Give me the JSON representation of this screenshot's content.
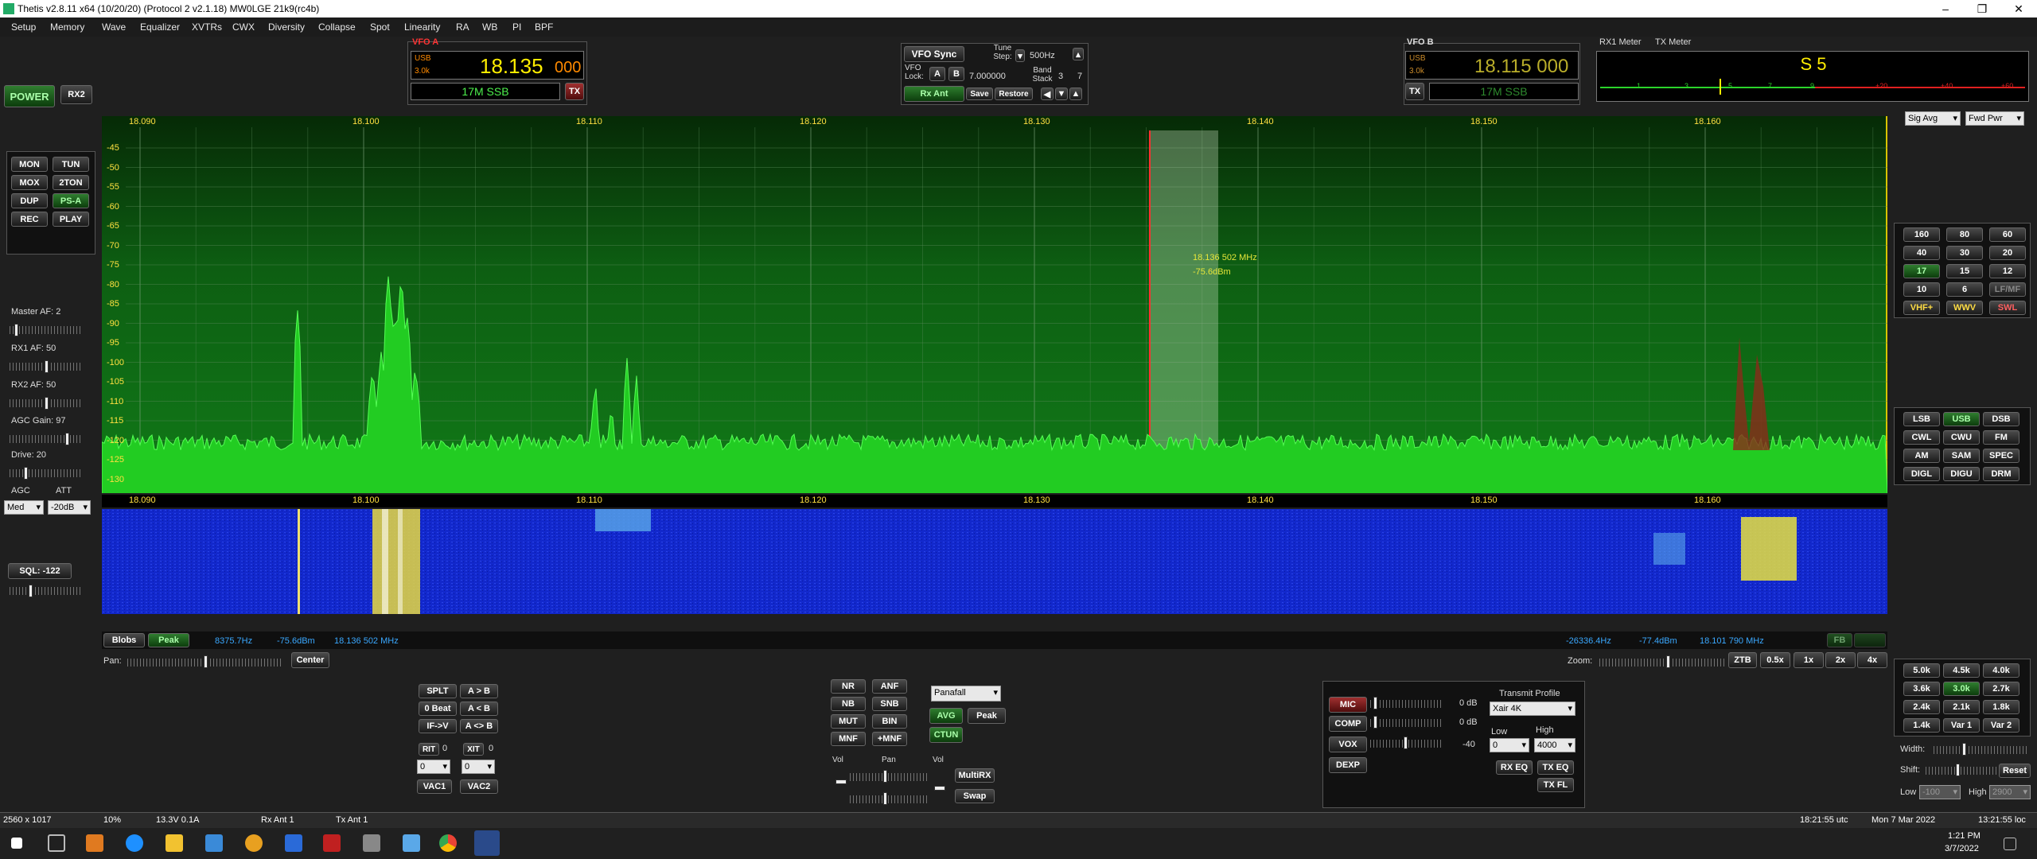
{
  "window": {
    "title": "Thetis v2.8.11 x64 (10/20/20) (Protocol 2 v2.1.18) MW0LGE 21k9(rc4b)"
  },
  "menu": [
    "Setup",
    "Memory",
    "Wave",
    "Equalizer",
    "XVTRs",
    "CWX",
    "Diversity",
    "Collapse",
    "Spot",
    "Linearity",
    "RA",
    "WB",
    "PI",
    "BPF"
  ],
  "left": {
    "power": "POWER",
    "rx2": "RX2",
    "buttons": [
      "MON",
      "TUN",
      "MOX",
      "2TON",
      "DUP",
      "PS-A",
      "REC",
      "PLAY"
    ],
    "master_af": "Master AF:  2",
    "rx1_af": "RX1 AF:  50",
    "rx2_af": "RX2 AF:  50",
    "agc_gain": "AGC Gain:  97",
    "drive": "Drive:  20",
    "agc": "AGC",
    "att": "ATT",
    "agc_val": "Med",
    "att_val": "-20dB",
    "sql": "SQL: -122"
  },
  "vfoa": {
    "label": "VFO A",
    "mode": "USB",
    "bw": "3.0k",
    "freq_main": "18.135",
    "freq_sub": "000",
    "band": "17M SSB",
    "tx": "TX"
  },
  "vfocenter": {
    "sync": "VFO Sync",
    "tune_step": "Tune Step:",
    "step": "500Hz",
    "vfo_lock": "VFO Lock:",
    "a": "A",
    "b": "B",
    "lock_freq": "7.000000",
    "band_stack": "Band Stack",
    "stack_a": "3",
    "stack_b": "7",
    "rx_ant": "Rx Ant",
    "save": "Save",
    "restore": "Restore"
  },
  "vfob": {
    "label": "VFO B",
    "mode": "USB",
    "bw": "3.0k",
    "freq": "18.115 000",
    "tx": "TX",
    "band": "17M SSB"
  },
  "meter": {
    "rx1": "RX1 Meter",
    "tx": "TX Meter",
    "reading": "S 5",
    "scale": [
      "1",
      "3",
      "5",
      "7",
      "9",
      "+20",
      "+40",
      "+60"
    ],
    "rx_mode": "Sig Avg",
    "tx_mode": "Fwd Pwr"
  },
  "display": {
    "freq_ticks": [
      "18.090",
      "18.100",
      "18.110",
      "18.120",
      "18.130",
      "18.140",
      "18.150",
      "18.160"
    ],
    "db_ticks": [
      "-45",
      "-50",
      "-55",
      "-60",
      "-65",
      "-70",
      "-75",
      "-80",
      "-85",
      "-90",
      "-95",
      "-100",
      "-105",
      "-110",
      "-115",
      "-120",
      "-125",
      "-130"
    ],
    "cursor_freq": "18.136 502 MHz",
    "cursor_db": "-75.6dBm",
    "blobs": "Blobs",
    "peak": "Peak",
    "info_left": [
      "8375.7Hz",
      "-75.6dBm",
      "18.136 502 MHz"
    ],
    "info_right": [
      "-26336.4Hz",
      "-77.4dBm",
      "18.101 790 MHz"
    ],
    "fb": "FB",
    "zoom_label": "Zoom:",
    "ztb": "ZTB",
    "zooms": [
      "0.5x",
      "1x",
      "2x",
      "4x"
    ],
    "pan_label": "Pan:",
    "center": "Center"
  },
  "bands": [
    "160",
    "80",
    "60",
    "40",
    "30",
    "20",
    "17",
    "15",
    "12",
    "10",
    "6",
    "LF/MF",
    "VHF+",
    "WWV",
    "SWL"
  ],
  "modes": [
    "LSB",
    "USB",
    "DSB",
    "CWL",
    "CWU",
    "FM",
    "AM",
    "SAM",
    "SPEC",
    "DIGL",
    "DIGU",
    "DRM"
  ],
  "filters": [
    "5.0k",
    "4.5k",
    "4.0k",
    "3.6k",
    "3.0k",
    "2.7k",
    "2.4k",
    "2.1k",
    "1.8k",
    "1.4k",
    "Var 1",
    "Var 2"
  ],
  "filterctl": {
    "width": "Width:",
    "shift": "Shift:",
    "reset": "Reset",
    "low": "Low",
    "high": "High",
    "low_val": "-100",
    "high_val": "2900"
  },
  "split": {
    "buttons": [
      "SPLT",
      "A > B",
      "0 Beat",
      "A < B",
      "IF->V",
      "A <> B"
    ],
    "rit": "RIT",
    "rit_val": "0",
    "xit": "XIT",
    "xit_val": "0",
    "rit_in": "0",
    "xit_in": "0",
    "vac1": "VAC1",
    "vac2": "VAC2"
  },
  "dsp": {
    "buttons": [
      "NR",
      "ANF",
      "NB",
      "SNB",
      "MUT",
      "BIN",
      "MNF",
      "+MNF"
    ],
    "vol": "Vol",
    "pan": "Pan",
    "vol2": "Vol",
    "multirx": "MultiRX",
    "swap": "Swap",
    "display_mode": "Panafall",
    "avg": "AVG",
    "peak": "Peak",
    "ctun": "CTUN"
  },
  "tx": {
    "mic": "MIC",
    "mic_db": "0 dB",
    "comp": "COMP",
    "comp_db": "0 dB",
    "vox": "VOX",
    "vox_db": "-40",
    "dexp": "DEXP",
    "profile_label": "Transmit Profile",
    "profile": "Xair 4K",
    "low": "Low",
    "high": "High",
    "low_val": "0",
    "high_val": "4000",
    "rx_eq": "RX EQ",
    "tx_eq": "TX EQ",
    "tx_fl": "TX FL"
  },
  "status": {
    "res": "2560 x 1017",
    "cpu": "10%",
    "volt": "13.3V  0.1A",
    "rx_ant": "Rx Ant 1",
    "tx_ant": "Tx Ant 1",
    "utc": "18:21:55 utc",
    "date": "Mon 7 Mar 2022",
    "local": "13:21:55 loc"
  },
  "taskbar": {
    "time": "1:21 PM",
    "date": "3/7/2022"
  }
}
